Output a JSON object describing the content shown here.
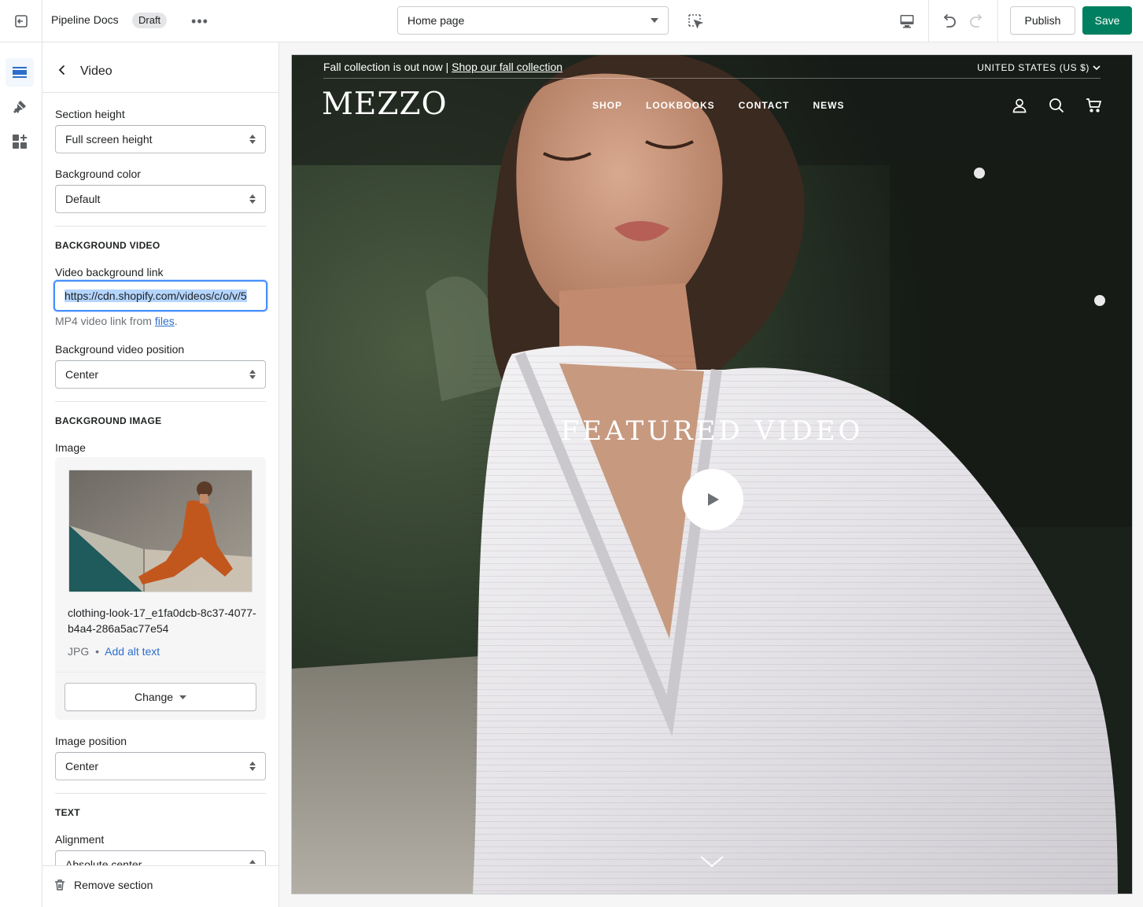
{
  "topbar": {
    "theme_name": "Pipeline Docs",
    "status_badge": "Draft",
    "more_label": "•••",
    "page_selector": "Home page",
    "publish_label": "Publish",
    "save_label": "Save",
    "colors": {
      "save_bg": "#008060",
      "border": "#c9cccf"
    }
  },
  "rail": {
    "items": [
      {
        "icon": "sections-icon",
        "active": true
      },
      {
        "icon": "theme-settings-icon",
        "active": false
      },
      {
        "icon": "app-embeds-icon",
        "active": false
      }
    ]
  },
  "panel": {
    "title": "Video",
    "section_height": {
      "label": "Section height",
      "value": "Full screen height"
    },
    "background_color": {
      "label": "Background color",
      "value": "Default"
    },
    "background_video_heading": "BACKGROUND VIDEO",
    "video_link": {
      "label": "Video background link",
      "value": "https://cdn.shopify.com/videos/c/o/v/5",
      "help_prefix": "MP4 video link from ",
      "help_link": "files",
      "help_suffix": "."
    },
    "video_position": {
      "label": "Background video position",
      "value": "Center"
    },
    "background_image_heading": "BACKGROUND IMAGE",
    "image": {
      "label": "Image",
      "filename": "clothing-look-17_e1fa0dcb-8c37-4077-b4a4-286a5ac77e54",
      "format": "JPG",
      "separator": "•",
      "alt_text_link": "Add alt text",
      "change_label": "Change"
    },
    "image_position": {
      "label": "Image position",
      "value": "Center"
    },
    "text_heading": "TEXT",
    "alignment": {
      "label": "Alignment",
      "value": "Absolute center"
    },
    "remove_label": "Remove section"
  },
  "preview": {
    "announcement_text": "Fall collection is out now | ",
    "announcement_link": "Shop our fall collection",
    "region": "UNITED STATES (US $)",
    "logo": "MEZZO",
    "nav": [
      "SHOP",
      "LOOKBOOKS",
      "CONTACT",
      "NEWS"
    ],
    "hero_title": "FEATURED VIDEO",
    "icons": [
      "account-icon",
      "search-icon",
      "cart-icon",
      "play-icon",
      "chevron-down-icon"
    ]
  }
}
